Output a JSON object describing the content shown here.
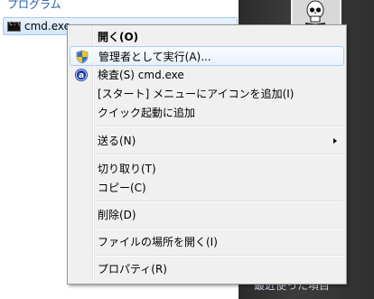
{
  "start_menu": {
    "programs_heading": "プログラム",
    "search_result": {
      "label": "cmd.exe",
      "icon": "cmd-icon"
    },
    "recent_items_label": "最近使った項目"
  },
  "context_menu": {
    "open": "開く(O)",
    "run_as_admin": "管理者として実行(A)...",
    "scan": "検査(S) cmd.exe",
    "pin_start_menu": "[スタート] メニューにアイコンを追加(I)",
    "add_quick_launch": "クイック起動に追加",
    "send_to": "送る(N)",
    "cut": "切り取り(T)",
    "copy": "コピー(C)",
    "delete": "削除(D)",
    "open_file_location": "ファイルの場所を開く(I)",
    "properties": "プロパティ(R)"
  },
  "colors": {
    "highlight_border": "#aecff7",
    "menu_background": "#f0f0f0",
    "programs_heading": "#1e5aa8",
    "right_panel": "#333333"
  },
  "icons": [
    "cmd-icon",
    "uac-shield-icon",
    "antivirus-scan-icon",
    "submenu-arrow-icon",
    "skull-avatar-icon"
  ]
}
